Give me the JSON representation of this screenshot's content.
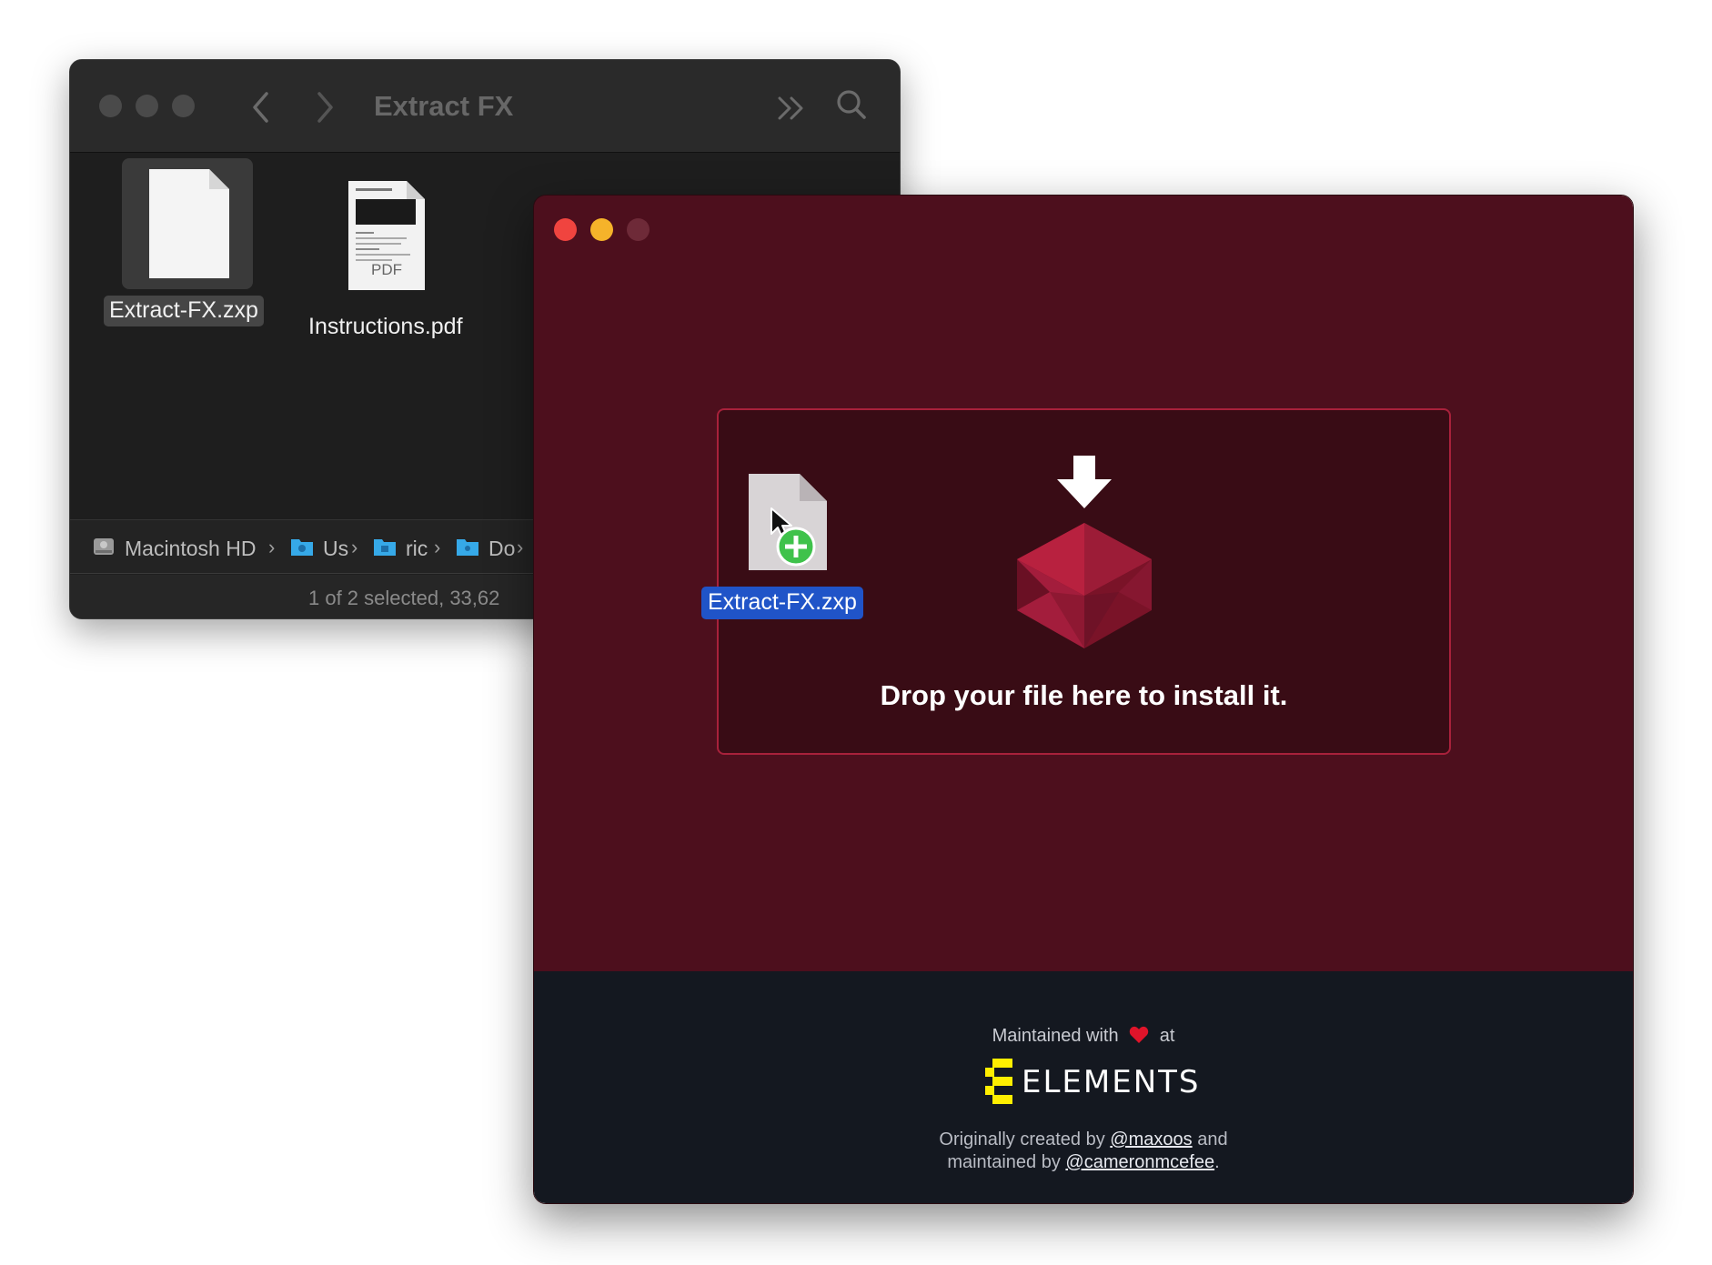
{
  "finder": {
    "title": "Extract FX",
    "files": [
      {
        "name": "Extract-FX.zxp",
        "selected": true,
        "icon": "document-icon"
      },
      {
        "name": "Instructions.pdf",
        "selected": false,
        "icon": "pdf-document-icon",
        "badge": "PDF"
      }
    ],
    "path": [
      {
        "label": "Macintosh HD",
        "icon": "hard-drive-icon"
      },
      {
        "label": "Us",
        "icon": "users-folder-icon"
      },
      {
        "label": "ric",
        "icon": "home-folder-icon"
      },
      {
        "label": "Do",
        "icon": "documents-folder-icon"
      }
    ],
    "status": "1 of 2 selected, 33,62"
  },
  "installer": {
    "drop_text": "Drop your file here to install it.",
    "dragged_file": "Extract-FX.zxp",
    "footer": {
      "maintained_prefix": "Maintained with",
      "maintained_suffix": "at",
      "logo_text": "ELEMENTS",
      "credits_line1_prefix": "Originally created by",
      "credits_author1": "@maxoos",
      "credits_line1_suffix": "and",
      "credits_line2_prefix": "maintained by",
      "credits_author2": "@cameronmcefee",
      "credits_line2_suffix": "."
    },
    "colors": {
      "background": "#4d0f1d",
      "dropzone": "#390c15",
      "dropzone_border": "#a8213b",
      "footer": "#141820",
      "logo_accent": "#ffee00"
    }
  }
}
